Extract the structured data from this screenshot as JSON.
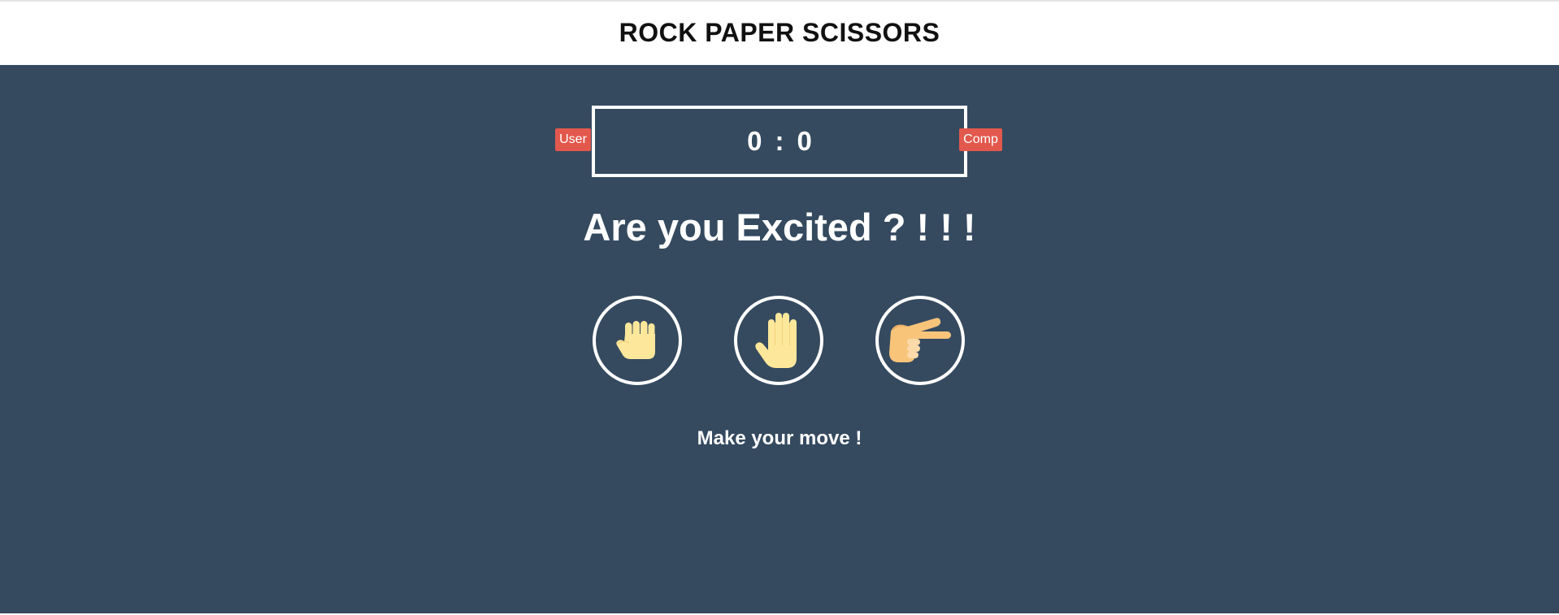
{
  "header": {
    "title": "ROCK PAPER SCISSORS"
  },
  "scoreboard": {
    "user_label": "User",
    "comp_label": "Comp",
    "user_score": "0",
    "separator": ":",
    "comp_score": "0"
  },
  "result": {
    "message": "Are you Excited ? ! ! !"
  },
  "choices": [
    {
      "name": "rock",
      "icon": "fist-hand-icon"
    },
    {
      "name": "paper",
      "icon": "open-hand-icon"
    },
    {
      "name": "scissors",
      "icon": "scissors-hand-icon"
    }
  ],
  "action": {
    "message": "Make your move !"
  },
  "colors": {
    "background": "#354a5f",
    "header_bg": "#ffffff",
    "badge": "#e2584d",
    "text": "#ffffff",
    "hand": "#fde79a",
    "hand_tan": "#f8c47a"
  }
}
